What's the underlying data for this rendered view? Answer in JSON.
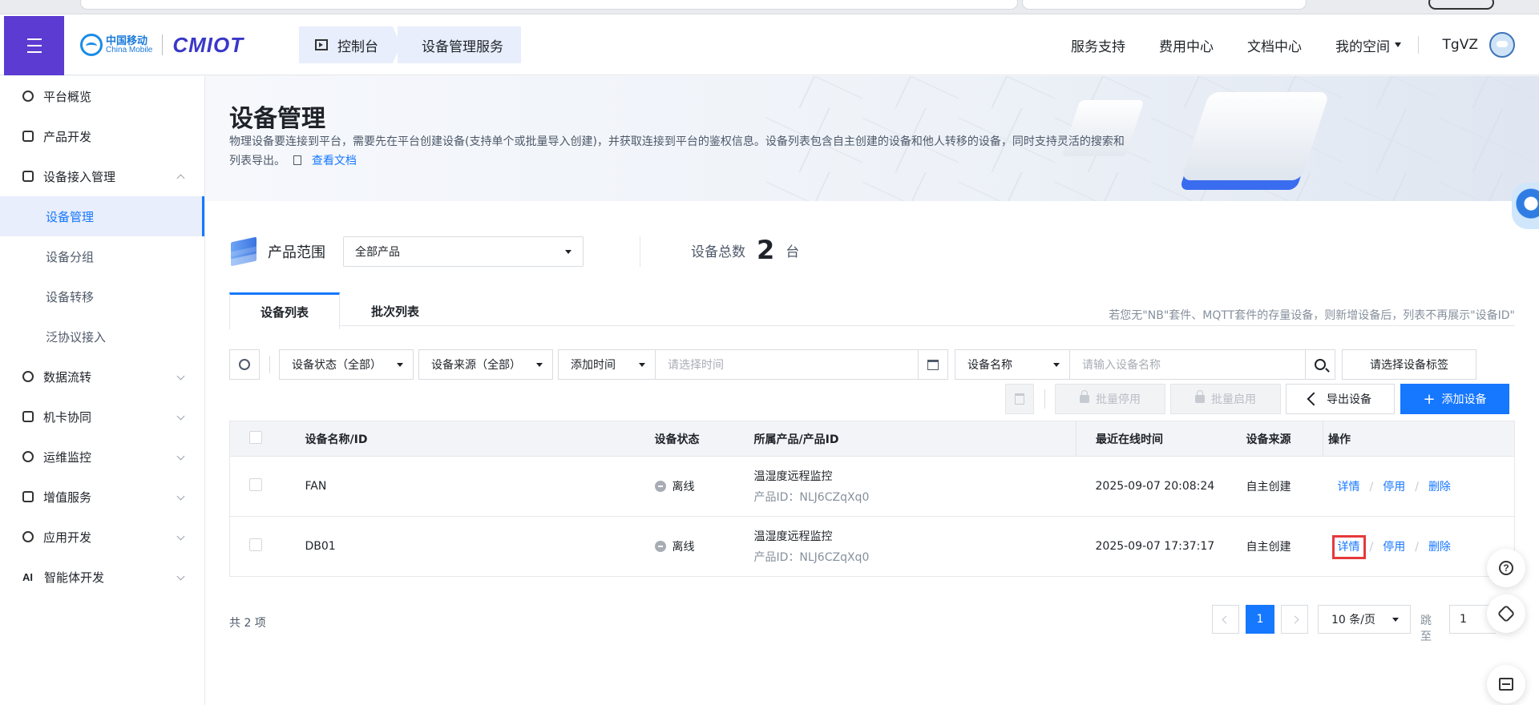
{
  "header": {
    "logo_cn": "中国移动",
    "logo_en": "China Mobile",
    "logo_brand": "CMIOT",
    "breadcrumbs": [
      "控制台",
      "设备管理服务"
    ],
    "nav": [
      "服务支持",
      "费用中心",
      "文档中心",
      "我的空间"
    ],
    "username": "TgVZ"
  },
  "sidebar": {
    "items": [
      {
        "label": "平台概览",
        "icon": "overview-icon"
      },
      {
        "label": "产品开发",
        "icon": "cube-icon"
      },
      {
        "label": "设备接入管理",
        "icon": "device-access-icon",
        "expanded": true,
        "children": [
          "设备管理",
          "设备分组",
          "设备转移",
          "泛协议接入"
        ],
        "active_child": "设备管理"
      },
      {
        "label": "数据流转",
        "icon": "data-flow-icon"
      },
      {
        "label": "机卡协同",
        "icon": "sim-card-icon"
      },
      {
        "label": "运维监控",
        "icon": "monitor-icon"
      },
      {
        "label": "增值服务",
        "icon": "value-added-icon"
      },
      {
        "label": "应用开发",
        "icon": "app-dev-icon"
      },
      {
        "label": "智能体开发",
        "icon": "ai-icon",
        "icon_text": "AI"
      }
    ]
  },
  "page": {
    "title": "设备管理",
    "description": "物理设备要连接到平台，需要先在平台创建设备(支持单个或批量导入创建)，并获取连接到平台的鉴权信息。设备列表包含自主创建的设备和他人转移的设备，同时支持灵活的搜索和列表导出。",
    "doc_link": "查看文档"
  },
  "scope": {
    "label": "产品范围",
    "selected": "全部产品",
    "total_label": "设备总数",
    "total_count": "2",
    "total_unit": "台"
  },
  "tabs": {
    "items": [
      "设备列表",
      "批次列表"
    ],
    "active": 0,
    "hint": "若您无\"NB\"套件、MQTT套件的存量设备，则新增设备后，列表不再展示\"设备ID\""
  },
  "filters": {
    "status": "设备状态（全部）",
    "source": "设备来源（全部）",
    "time_type": "添加时间",
    "time_placeholder": "请选择时间",
    "search_field": "设备名称",
    "search_placeholder": "请输入设备名称",
    "tag_button": "请选择设备标签"
  },
  "actions": {
    "batch_disable": "批量停用",
    "batch_enable": "批量启用",
    "export": "导出设备",
    "add": "添加设备"
  },
  "table": {
    "columns": [
      "设备名称/ID",
      "设备状态",
      "所属产品/产品ID",
      "最近在线时间",
      "设备来源",
      "操作"
    ],
    "rows": [
      {
        "name": "FAN",
        "status": "离线",
        "product": "温湿度远程监控",
        "product_id": "产品ID：NLJ6CZqXq0",
        "last_online": "2025-09-07 20:08:24",
        "source": "自主创建"
      },
      {
        "name": "DB01",
        "status": "离线",
        "product": "温湿度远程监控",
        "product_id": "产品ID：NLJ6CZqXq0",
        "last_online": "2025-09-07 17:37:17",
        "source": "自主创建"
      }
    ],
    "ops": {
      "detail": "详情",
      "disable": "停用",
      "delete": "删除",
      "sep": "/"
    }
  },
  "pagination": {
    "total_text": "共 2 项",
    "current_page": "1",
    "page_size": "10 条/页",
    "jump_label": "跳至",
    "jump_value": "1"
  },
  "colors": {
    "accent": "#1677ff",
    "menu_button": "#5b3bd1",
    "highlight_box": "#e5393b"
  }
}
